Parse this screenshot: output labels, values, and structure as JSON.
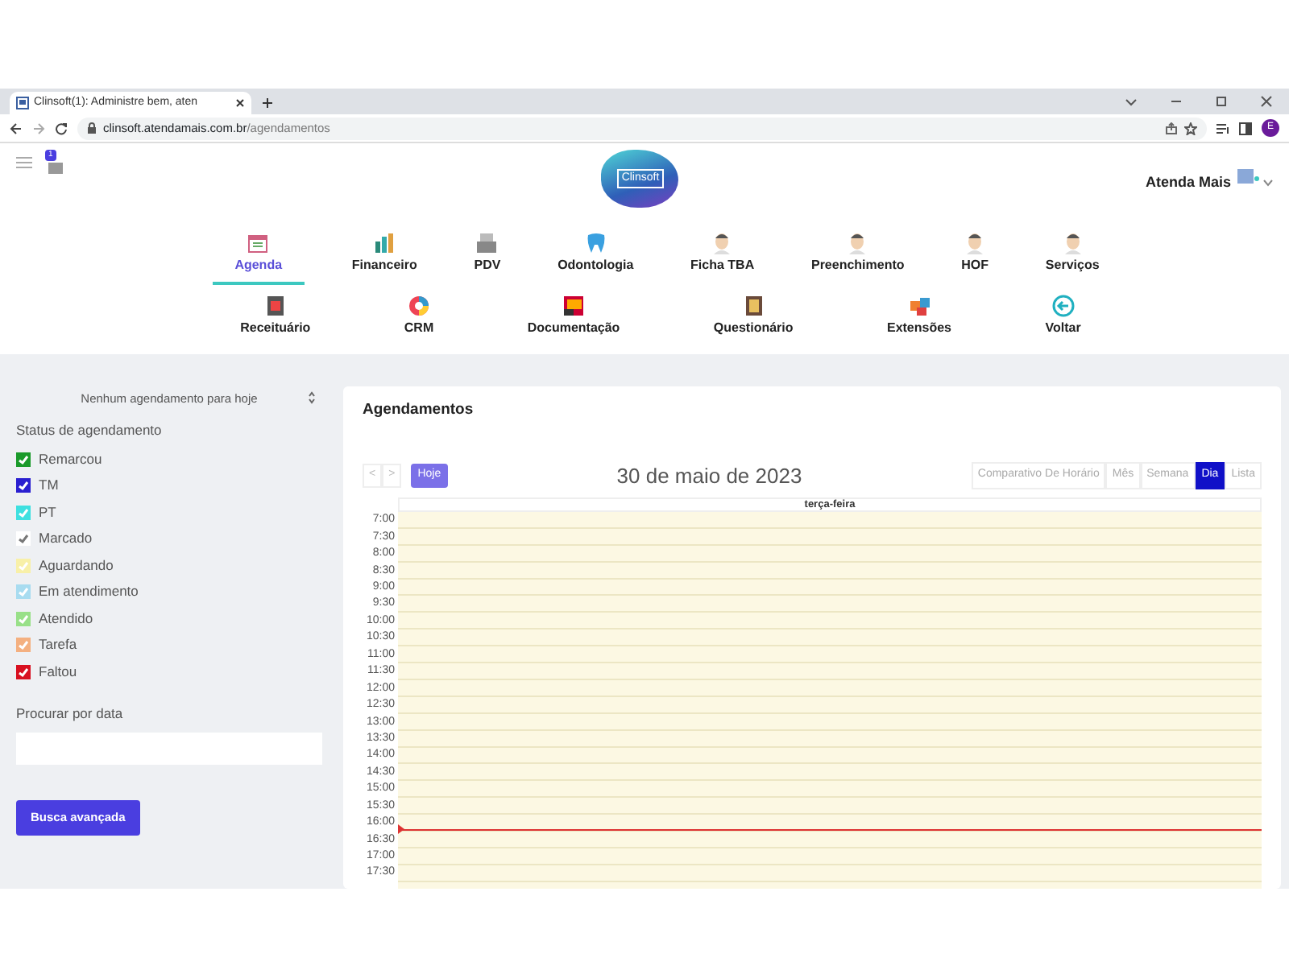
{
  "browser": {
    "tab_title": "Clinsoft(1): Administre bem, aten",
    "url_host": "clinsoft.atendamais.com.br",
    "url_path": "/agendamentos",
    "profile_initial": "E"
  },
  "header": {
    "notification_count": "1",
    "logo_text": "Clinsoft",
    "user_name": "Atenda Mais"
  },
  "module_rows": [
    {
      "items": [
        {
          "label": "Agenda",
          "selected": true
        },
        {
          "label": "Financeiro",
          "selected": false
        },
        {
          "label": "PDV",
          "selected": false
        },
        {
          "label": "Odontologia",
          "selected": false
        },
        {
          "label": "Ficha TBA",
          "selected": false
        },
        {
          "label": "Preenchimento",
          "selected": false
        },
        {
          "label": "HOF",
          "selected": false
        },
        {
          "label": "Serviços",
          "selected": false
        }
      ]
    },
    {
      "items": [
        {
          "label": "Receituário",
          "selected": false
        },
        {
          "label": "CRM",
          "selected": false
        },
        {
          "label": "Documentação",
          "selected": false
        },
        {
          "label": "Questionário",
          "selected": false
        },
        {
          "label": "Extensões",
          "selected": false
        },
        {
          "label": "Voltar",
          "selected": false
        }
      ]
    }
  ],
  "sidebar": {
    "today_select": "Nenhum agendamento para hoje",
    "status_title": "Status de agendamento",
    "statuses": [
      {
        "label": "Remarcou",
        "checked": true,
        "color": "#1a9a2a"
      },
      {
        "label": "TM",
        "checked": true,
        "color": "#2a1fd0"
      },
      {
        "label": "PT",
        "checked": true,
        "color": "#3ee0e0"
      },
      {
        "label": "Marcado",
        "checked": true,
        "color": "#ffffff"
      },
      {
        "label": "Aguardando",
        "checked": true,
        "color": "#f8f0a8"
      },
      {
        "label": "Em atendimento",
        "checked": true,
        "color": "#a8dcf0"
      },
      {
        "label": "Atendido",
        "checked": true,
        "color": "#98e088"
      },
      {
        "label": "Tarefa",
        "checked": true,
        "color": "#f4b080"
      },
      {
        "label": "Faltou",
        "checked": true,
        "color": "#d81020"
      }
    ],
    "search_label": "Procurar por data",
    "advanced_button": "Busca avançada"
  },
  "calendar": {
    "title": "Agendamentos",
    "prev": "<",
    "next": ">",
    "today_button": "Hoje",
    "date": "30 de maio de 2023",
    "views": [
      {
        "label": "Comparativo De Horário",
        "selected": false
      },
      {
        "label": "Mês",
        "selected": false
      },
      {
        "label": "Semana",
        "selected": false
      },
      {
        "label": "Dia",
        "selected": true
      },
      {
        "label": "Lista",
        "selected": false
      }
    ],
    "day_header": "terça-feira",
    "times": [
      "7:00",
      "7:30",
      "8:00",
      "8:30",
      "9:00",
      "9:30",
      "10:00",
      "10:30",
      "11:00",
      "11:30",
      "12:00",
      "12:30",
      "13:00",
      "13:30",
      "14:00",
      "14:30",
      "15:00",
      "15:30",
      "16:00",
      "16:30",
      "17:00",
      "17:30"
    ]
  }
}
